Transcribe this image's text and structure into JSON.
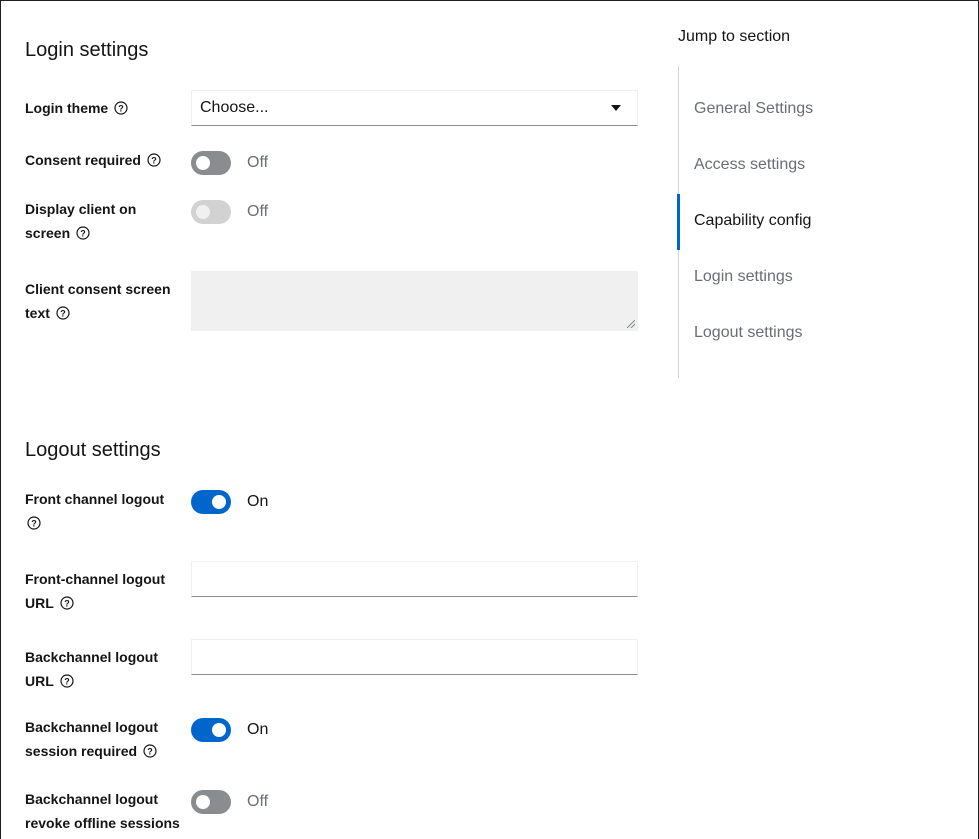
{
  "login_settings": {
    "title": "Login settings",
    "login_theme": {
      "label": "Login theme",
      "placeholder": "Choose..."
    },
    "consent_required": {
      "label": "Consent required",
      "state": "Off"
    },
    "display_client_on_screen": {
      "label_line1": "Display client on",
      "label_line2": "screen",
      "state": "Off"
    },
    "client_consent_screen_text": {
      "label_line1": "Client consent screen",
      "label_line2": "text",
      "value": ""
    }
  },
  "logout_settings": {
    "title": "Logout settings",
    "front_channel_logout": {
      "label": "Front channel logout",
      "state": "On"
    },
    "front_channel_logout_url": {
      "label_line1": "Front-channel logout",
      "label_line2": "URL",
      "value": ""
    },
    "backchannel_logout_url": {
      "label_line1": "Backchannel logout",
      "label_line2": "URL",
      "value": ""
    },
    "backchannel_logout_session_required": {
      "label_line1": "Backchannel logout",
      "label_line2": "session required",
      "state": "On"
    },
    "backchannel_logout_revoke_offline": {
      "label_line1": "Backchannel logout",
      "label_line2": "revoke offline sessions",
      "state": "Off"
    }
  },
  "jump_to_section": {
    "title": "Jump to section",
    "items": [
      {
        "label": "General Settings",
        "active": false
      },
      {
        "label": "Access settings",
        "active": false
      },
      {
        "label": "Capability config",
        "active": true
      },
      {
        "label": "Login settings",
        "active": false
      },
      {
        "label": "Logout settings",
        "active": false
      }
    ]
  },
  "icons": {
    "help": "help-circle-icon",
    "caret": "caret-down-icon"
  },
  "colors": {
    "accent": "#0066cc",
    "switch_off": "#8a8d90",
    "switch_disabled": "#d2d2d2",
    "muted_text": "#6a6e73"
  }
}
